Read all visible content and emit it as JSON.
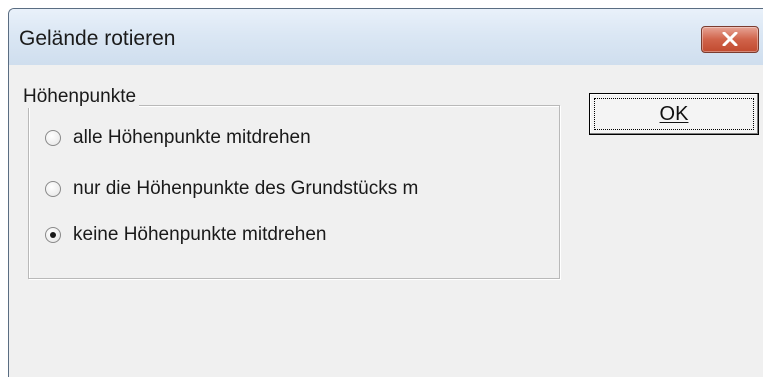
{
  "window": {
    "title": "Gelände rotieren",
    "close_icon": "close-icon"
  },
  "group": {
    "label": "Höhenpunkte",
    "options": [
      {
        "label": "alle Höhenpunkte mitdrehen",
        "selected": false
      },
      {
        "label": "nur die Höhenpunkte des Grundstücks m",
        "selected": false
      },
      {
        "label": "keine Höhenpunkte mitdrehen",
        "selected": true
      }
    ]
  },
  "buttons": {
    "ok_label": "OK"
  },
  "colors": {
    "dialog_background": "#f0f0f0",
    "close_button": "#c94f35",
    "titlebar": "#dbe7f4"
  }
}
